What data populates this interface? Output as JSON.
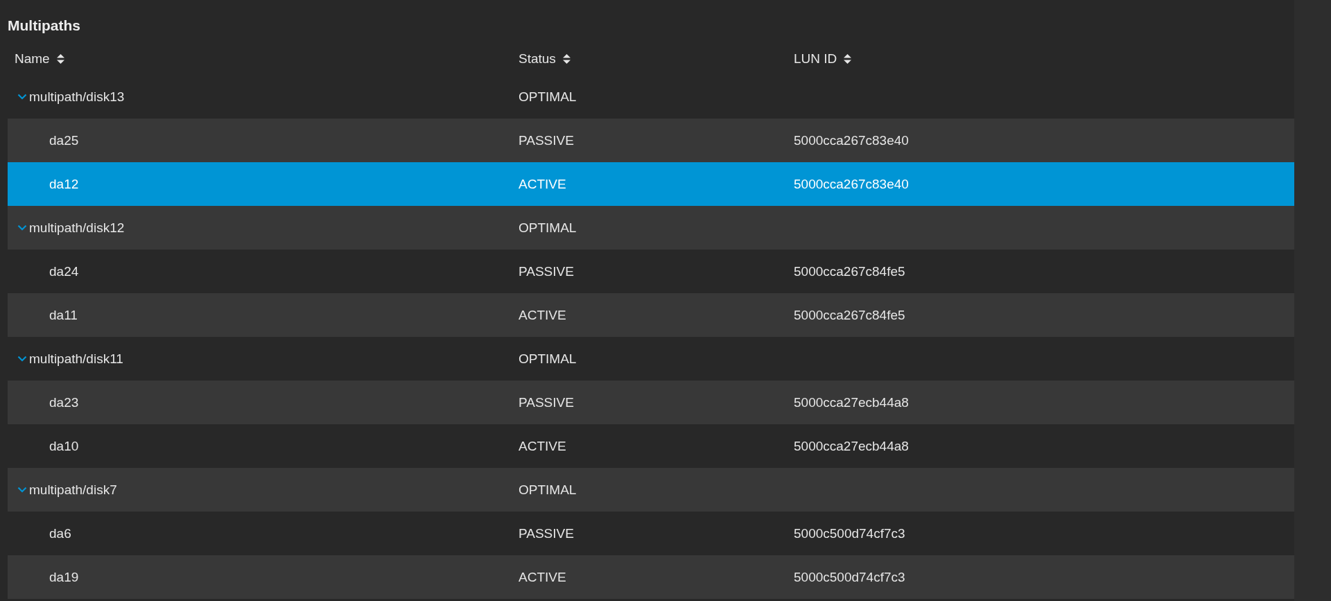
{
  "title": "Multipaths",
  "columns": [
    {
      "label": "Name",
      "sort_icon": true
    },
    {
      "label": "Status",
      "sort_icon": true
    },
    {
      "label": "LUN ID",
      "sort_icon": true
    }
  ],
  "groups": [
    {
      "name": "multipath/disk13",
      "status": "OPTIMAL",
      "expanded": true,
      "selected": false,
      "children": [
        {
          "name": "da25",
          "status": "PASSIVE",
          "lun_id": "5000cca267c83e40",
          "selected": false
        },
        {
          "name": "da12",
          "status": "ACTIVE",
          "lun_id": "5000cca267c83e40",
          "selected": true
        }
      ]
    },
    {
      "name": "multipath/disk12",
      "status": "OPTIMAL",
      "expanded": true,
      "selected": false,
      "children": [
        {
          "name": "da24",
          "status": "PASSIVE",
          "lun_id": "5000cca267c84fe5",
          "selected": false
        },
        {
          "name": "da11",
          "status": "ACTIVE",
          "lun_id": "5000cca267c84fe5",
          "selected": false
        }
      ]
    },
    {
      "name": "multipath/disk11",
      "status": "OPTIMAL",
      "expanded": true,
      "selected": false,
      "children": [
        {
          "name": "da23",
          "status": "PASSIVE",
          "lun_id": "5000cca27ecb44a8",
          "selected": false
        },
        {
          "name": "da10",
          "status": "ACTIVE",
          "lun_id": "5000cca27ecb44a8",
          "selected": false
        }
      ]
    },
    {
      "name": "multipath/disk7",
      "status": "OPTIMAL",
      "expanded": true,
      "selected": false,
      "children": [
        {
          "name": "da6",
          "status": "PASSIVE",
          "lun_id": "5000c500d74cf7c3",
          "selected": false
        },
        {
          "name": "da19",
          "status": "ACTIVE",
          "lun_id": "5000c500d74cf7c3",
          "selected": false
        }
      ]
    }
  ]
}
